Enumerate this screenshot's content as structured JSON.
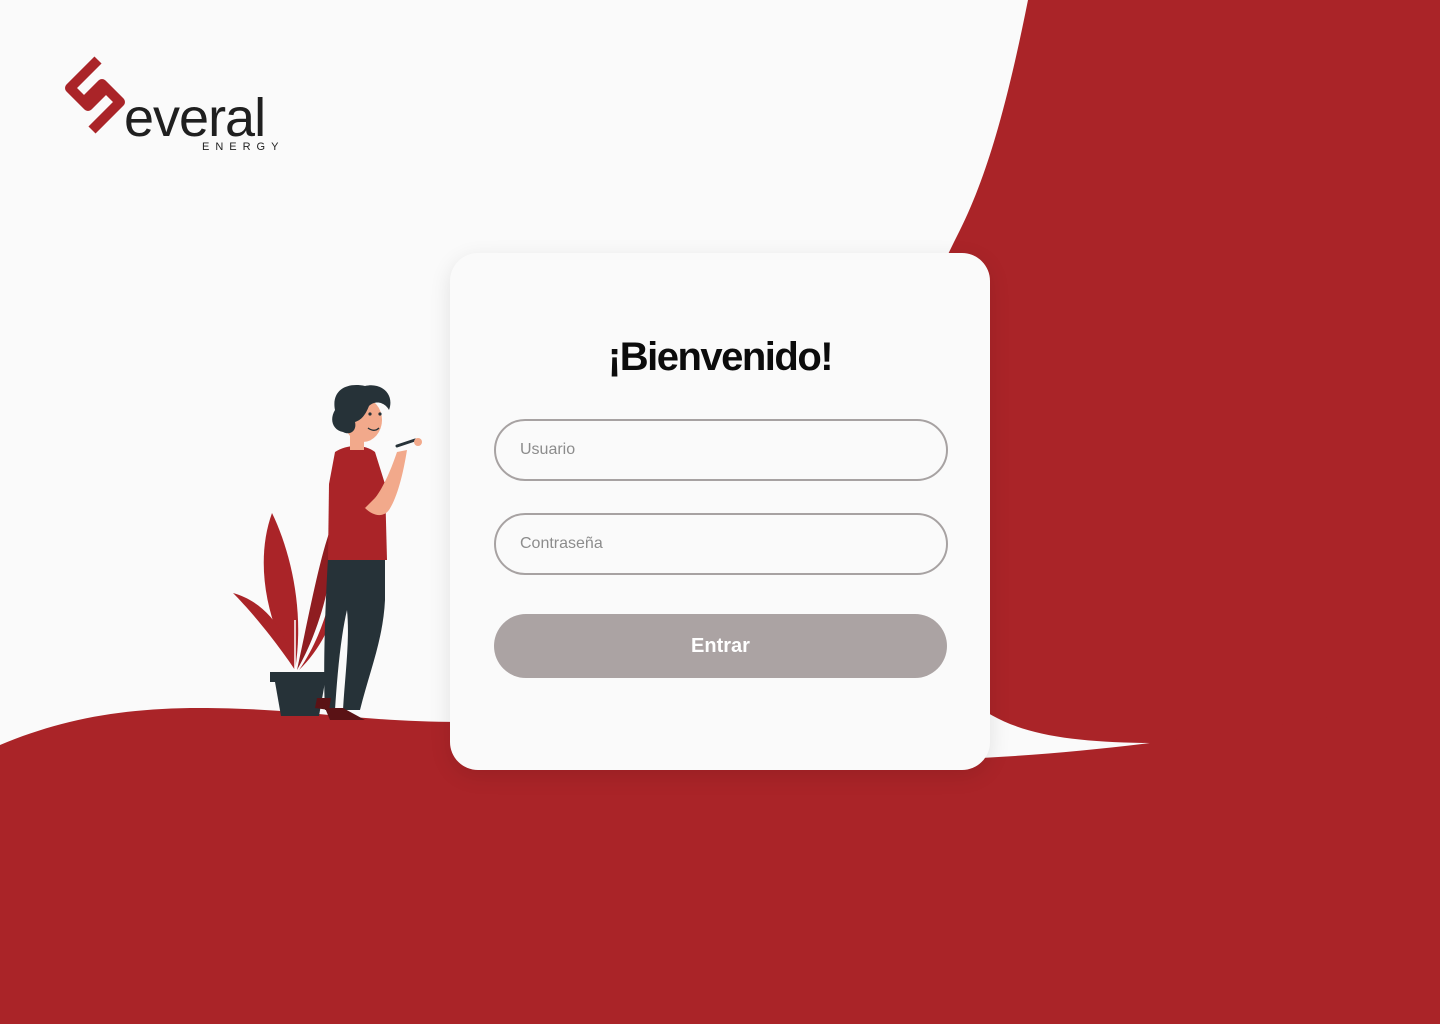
{
  "brand": {
    "name": "everal",
    "tagline": "ENERGY",
    "logo_icon": "s-monogram-icon",
    "accent_color": "#aa2428",
    "text_color": "#1f1f1f"
  },
  "login": {
    "title": "¡Bienvenido!",
    "username_placeholder": "Usuario",
    "password_placeholder": "Contraseña",
    "submit_label": "Entrar"
  },
  "colors": {
    "background": "#fafafa",
    "accent": "#aa2428",
    "button_disabled": "#aba3a3",
    "field_border": "#a7a2a2"
  }
}
